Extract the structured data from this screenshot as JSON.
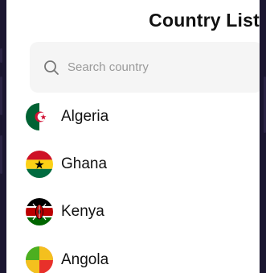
{
  "header": {
    "title": "Country List"
  },
  "search": {
    "placeholder": "Search country",
    "icon": "search-icon"
  },
  "countries": [
    {
      "name": "Algeria",
      "flag": "algeria-flag-icon"
    },
    {
      "name": "Ghana",
      "flag": "ghana-flag-icon"
    },
    {
      "name": "Kenya",
      "flag": "kenya-flag-icon"
    },
    {
      "name": "Angola",
      "flag": "angola-flag-icon"
    }
  ],
  "colors": {
    "frame": "#1b1630",
    "search_bg": "#f5f5f5",
    "placeholder": "#9a9a9a",
    "text": "#111111"
  }
}
